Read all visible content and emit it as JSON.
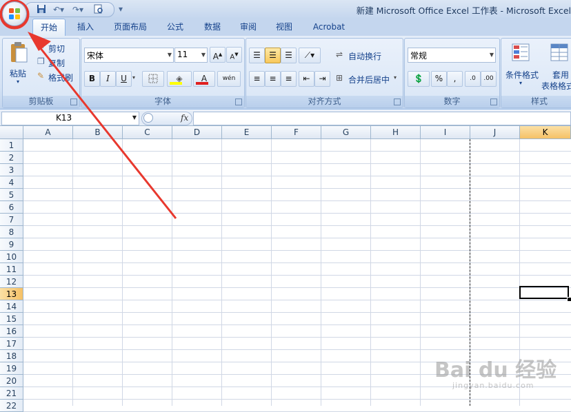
{
  "window": {
    "title": "新建 Microsoft Office Excel 工作表 - Microsoft Excel"
  },
  "ribbon_tabs": [
    "开始",
    "插入",
    "页面布局",
    "公式",
    "数据",
    "审阅",
    "视图",
    "Acrobat"
  ],
  "clipboard": {
    "paste": "粘贴",
    "cut": "剪切",
    "copy": "复制",
    "format_painter": "格式刷",
    "label": "剪贴板"
  },
  "font": {
    "name": "宋体",
    "size": "11",
    "label": "字体",
    "bold": "B",
    "italic": "I",
    "underline": "U",
    "color_glyph": "A",
    "phonetic": "wén"
  },
  "alignment": {
    "wrap": "自动换行",
    "merge": "合并后居中",
    "label": "对齐方式"
  },
  "number": {
    "format": "常规",
    "percent": "%",
    "comma": ",",
    "label": "数字"
  },
  "styles": {
    "conditional": "条件格式",
    "table_line1": "套用",
    "table_line2": "表格格式",
    "label": "样式"
  },
  "formula_bar": {
    "name_box": "K13",
    "fx": "fx",
    "formula": ""
  },
  "columns": [
    "A",
    "B",
    "C",
    "D",
    "E",
    "F",
    "G",
    "H",
    "I",
    "J",
    "K"
  ],
  "rows": [
    "1",
    "2",
    "3",
    "4",
    "5",
    "6",
    "7",
    "8",
    "9",
    "10",
    "11",
    "12",
    "13",
    "14",
    "15",
    "16",
    "17",
    "18",
    "19",
    "20",
    "21",
    "22"
  ],
  "selection": {
    "column": "K",
    "row": "13"
  },
  "watermark": {
    "brand": "Bai du 经验",
    "url": "jingyan.baidu.com"
  },
  "colors": {
    "annotation": "#e8382e",
    "selection": "#f5c166"
  },
  "icons": [
    "office-button-icon",
    "save-icon",
    "undo-icon",
    "redo-icon",
    "print-preview-icon",
    "qat-dropdown-icon"
  ]
}
